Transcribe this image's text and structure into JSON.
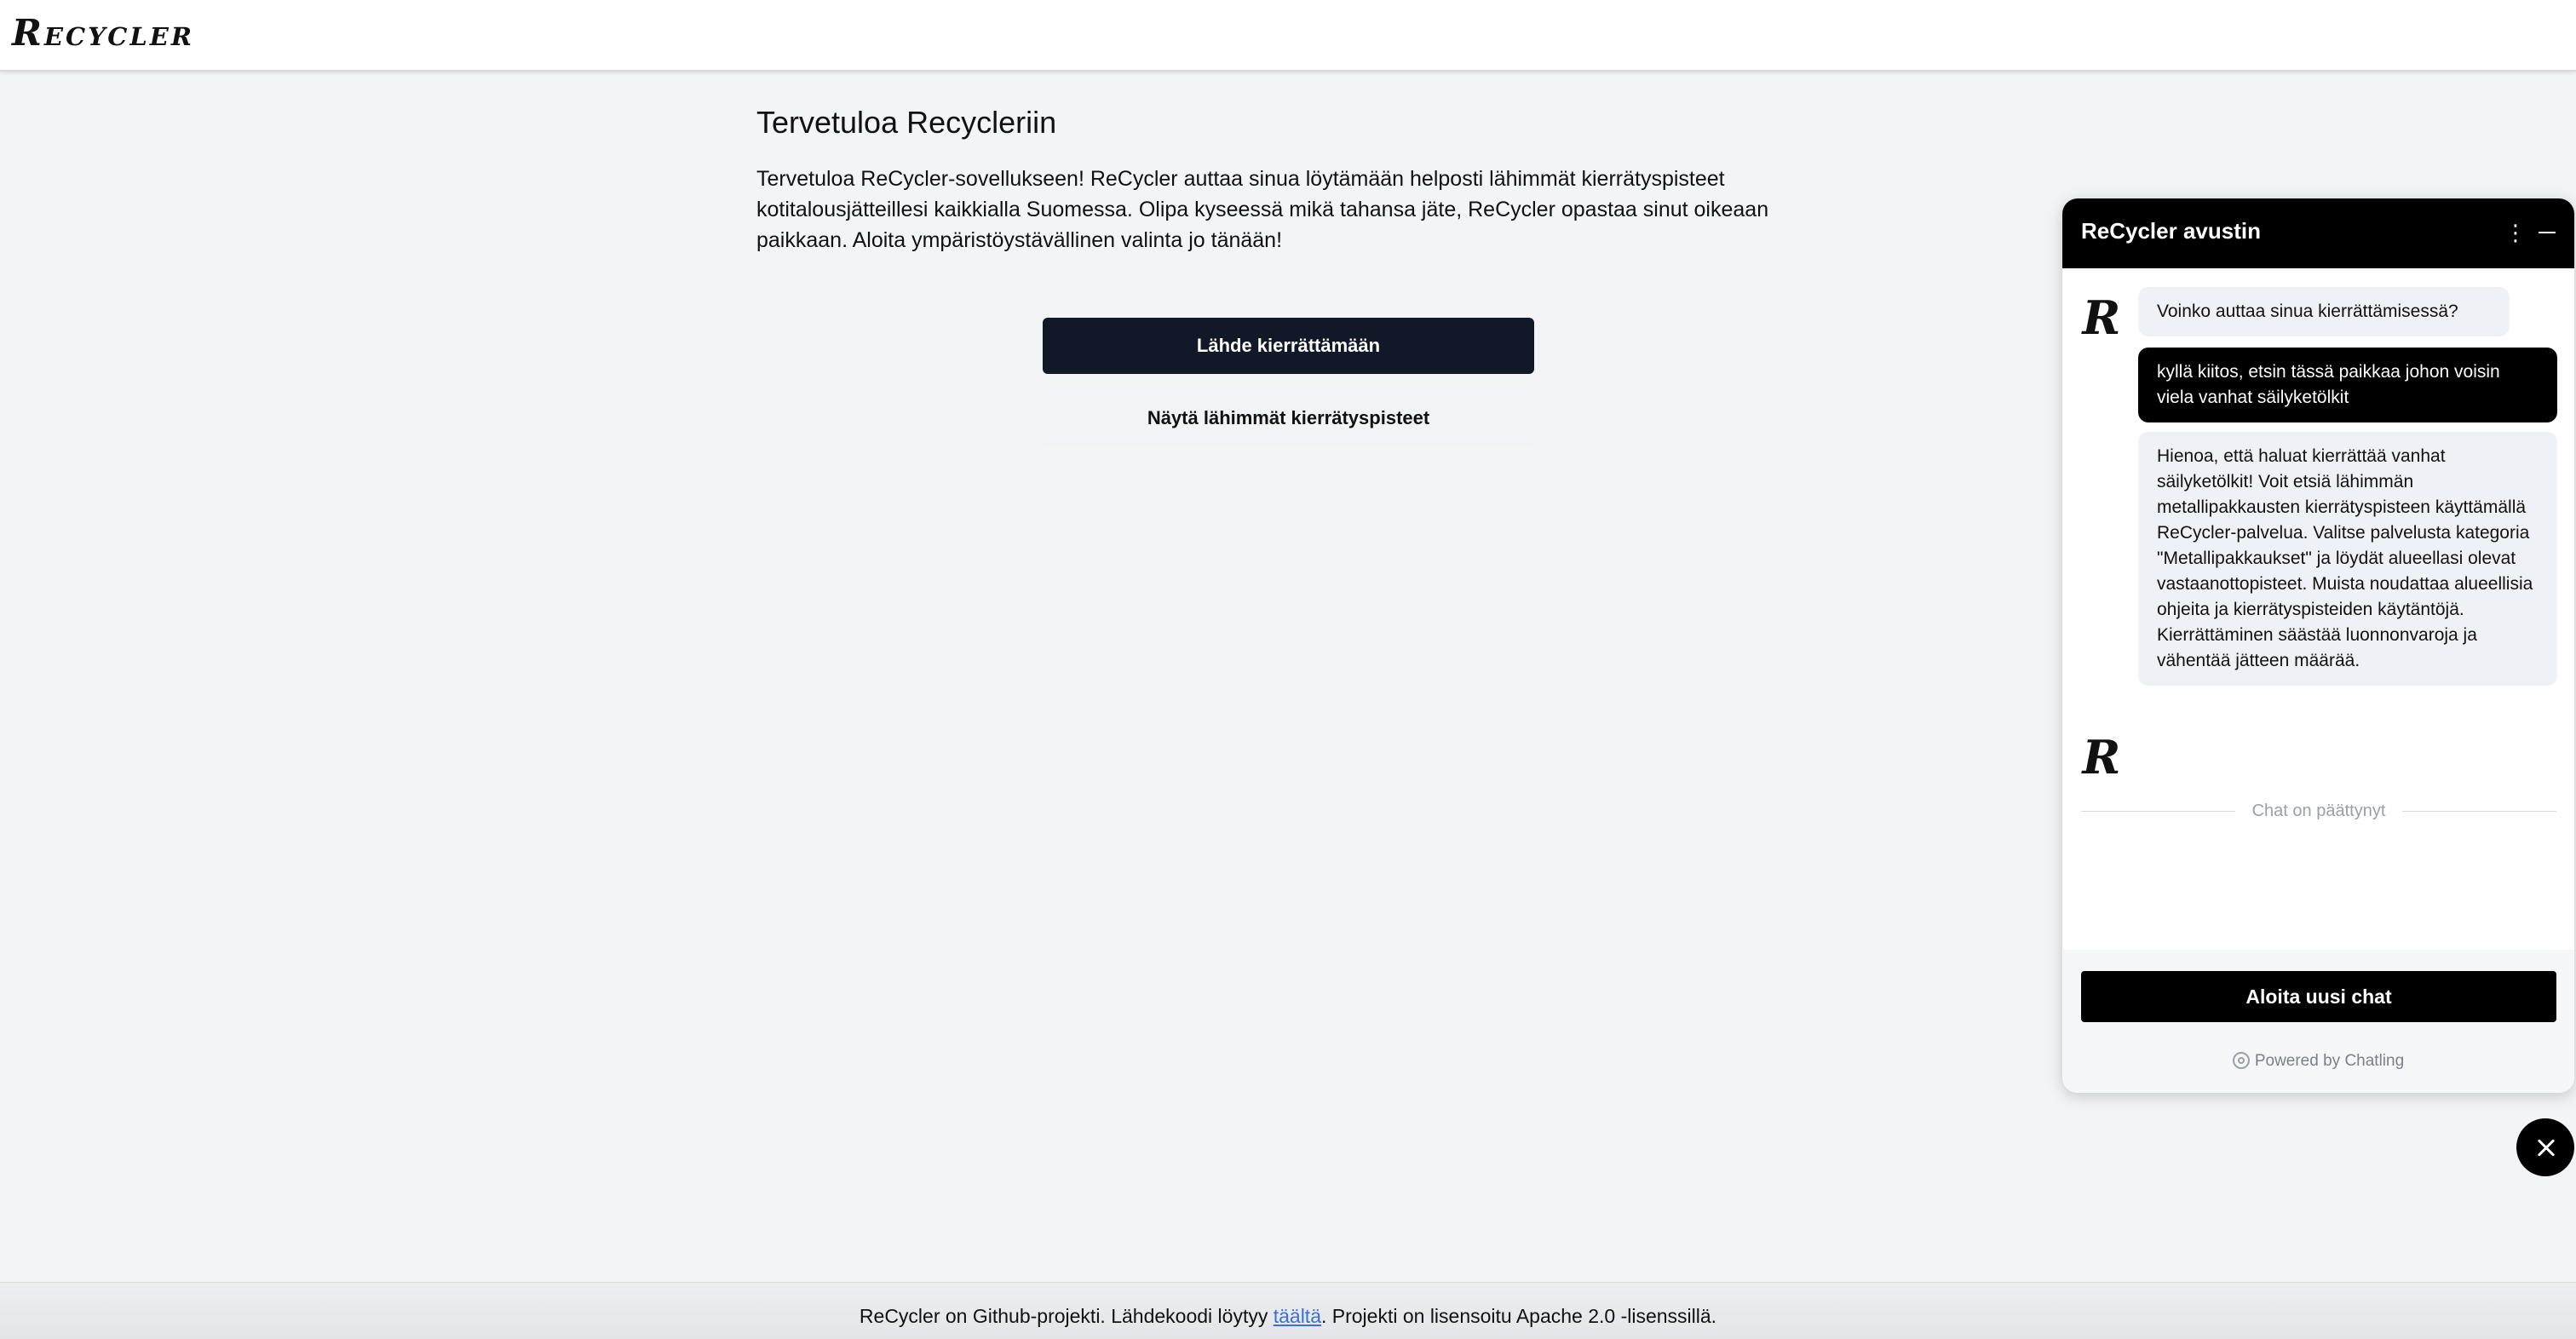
{
  "header": {
    "logo": "Recycler"
  },
  "main": {
    "title": "Tervetuloa Recycleriin",
    "intro": "Tervetuloa ReCycler-sovellukseen! ReCycler auttaa sinua löytämään helposti lähimmät kierrätyspisteet kotitalousjätteillesi kaikkialla Suomessa. Olipa kyseessä mikä tahansa jäte, ReCycler opastaa sinut oikeaan paikkaan. Aloita ympäristöystävällinen valinta jo tänään!",
    "primary_button": "Lähde kierrättämään",
    "secondary_button": "Näytä lähimmät kierrätyspisteet"
  },
  "footer": {
    "text_before": "ReCycler on Github-projekti. Lähdekoodi löytyy ",
    "link": "täältä",
    "text_after": ". Projekti on lisensoitu Apache 2.0 -lisenssillä."
  },
  "chat": {
    "title": "ReCycler avustin",
    "more_icon": "⋮",
    "messages": [
      {
        "role": "bot",
        "text": "Voinko auttaa sinua kierrättämisessä?"
      },
      {
        "role": "user",
        "text": "kyllä kiitos, etsin tässä paikkaa johon voisin viela vanhat säilyketölkit"
      },
      {
        "role": "bot",
        "text": "Hienoa, että haluat kierrättää vanhat säilyketölkit! Voit etsiä lähimmän metallipakkausten kierrätyspisteen käyttämällä ReCycler-palvelua. Valitse palvelusta kategoria \"Metallipakkaukset\" ja löydät alueellasi olevat vastaanottopisteet. Muista noudattaa alueellisia ohjeita ja kierrätyspisteiden käytäntöjä. Kierrättäminen säästää luonnonvaroja ja vähentää jätteen määrää."
      }
    ],
    "avatar_letter": "R",
    "ended_label": "Chat on päättynyt",
    "new_chat_button": "Aloita uusi chat",
    "powered_by": "Powered by Chatling"
  }
}
